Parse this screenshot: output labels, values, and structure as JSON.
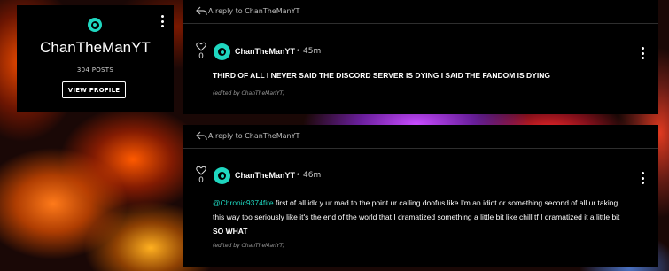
{
  "profile": {
    "name": "ChanTheManYT",
    "posts": "304 POSTS",
    "view_profile": "VIEW PROFILE"
  },
  "replies": [
    {
      "reply_to": "A reply to ChanTheManYT",
      "likes": "0",
      "author": "ChanTheManYT",
      "separator": "•",
      "time": "45m",
      "text": "THIRD OF ALL I NEVER SAID THE DISCORD SERVER IS DYING I SAID THE FANDOM IS DYING",
      "edited": "(edited by ChanTheManYT)"
    },
    {
      "reply_to": "A reply to ChanTheManYT",
      "likes": "0",
      "author": "ChanTheManYT",
      "separator": "•",
      "time": "46m",
      "mention": "@Chronic9374fire",
      "text": " first of all idk y ur mad to the point ur calling doofus like I'm an idiot or something second of all ur taking this way too seriously like it's the end of the world that I dramatized something a little bit like chill tf I dramatized it a little bit ",
      "bold_end": "SO WHAT",
      "edited": "(edited by ChanTheManYT)"
    }
  ],
  "colors": {
    "accent": "#1fd7c0",
    "card": "#000000"
  },
  "icons": [
    "reply-arrow-icon",
    "heart-icon",
    "more-options-icon",
    "community-logo-icon"
  ]
}
